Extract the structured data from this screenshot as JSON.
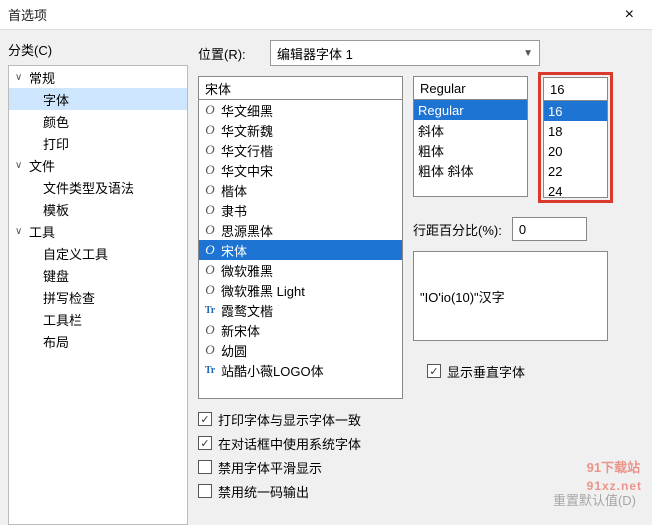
{
  "titlebar": {
    "title": "首选项",
    "close": "×"
  },
  "sidebar": {
    "label": "分类(C)",
    "groups": [
      {
        "label": "常规",
        "children": [
          "字体",
          "颜色",
          "打印"
        ],
        "selectedChild": 0
      },
      {
        "label": "文件",
        "children": [
          "文件类型及语法",
          "模板"
        ]
      },
      {
        "label": "工具",
        "children": [
          "自定义工具",
          "键盘",
          "拼写检查",
          "工具栏",
          "布局"
        ]
      }
    ]
  },
  "location": {
    "label": "位置(R):",
    "value": "编辑器字体 1"
  },
  "font": {
    "input": "宋体",
    "items": [
      {
        "ico": "O",
        "label": "华文细黑"
      },
      {
        "ico": "O",
        "label": "华文新魏"
      },
      {
        "ico": "O",
        "label": "华文行楷"
      },
      {
        "ico": "O",
        "label": "华文中宋"
      },
      {
        "ico": "O",
        "label": "楷体"
      },
      {
        "ico": "O",
        "label": "隶书"
      },
      {
        "ico": "O",
        "label": "思源黑体"
      },
      {
        "ico": "O",
        "label": "宋体",
        "selected": true
      },
      {
        "ico": "O",
        "label": "微软雅黑"
      },
      {
        "ico": "O",
        "label": "微软雅黑 Light"
      },
      {
        "ico": "Tr",
        "label": "霞鹜文楷"
      },
      {
        "ico": "O",
        "label": "新宋体"
      },
      {
        "ico": "O",
        "label": "幼圆"
      },
      {
        "ico": "Tr",
        "label": "站酷小薇LOGO体"
      }
    ]
  },
  "style": {
    "input": "Regular",
    "items": [
      {
        "label": "Regular",
        "selected": true
      },
      {
        "label": "斜体"
      },
      {
        "label": "粗体"
      },
      {
        "label": "粗体 斜体"
      }
    ]
  },
  "size": {
    "input": "16",
    "items": [
      {
        "label": "16",
        "selected": true
      },
      {
        "label": "18"
      },
      {
        "label": "20"
      },
      {
        "label": "22"
      },
      {
        "label": "24"
      }
    ]
  },
  "spacing": {
    "label": "行距百分比(%):",
    "value": "0"
  },
  "preview": {
    "text": "\"IO'io(10)\"汉字"
  },
  "checks": {
    "left": [
      {
        "label": "打印字体与显示字体一致",
        "checked": true
      },
      {
        "label": "在对话框中使用系统字体",
        "checked": true
      },
      {
        "label": "禁用字体平滑显示",
        "checked": false
      },
      {
        "label": "禁用统一码输出",
        "checked": false
      }
    ],
    "right": [
      {
        "label": "显示垂直字体",
        "checked": true
      }
    ]
  },
  "reset": "重置默认值(D)",
  "watermark": {
    "big": "91下载站",
    "small": "91xz.net"
  }
}
